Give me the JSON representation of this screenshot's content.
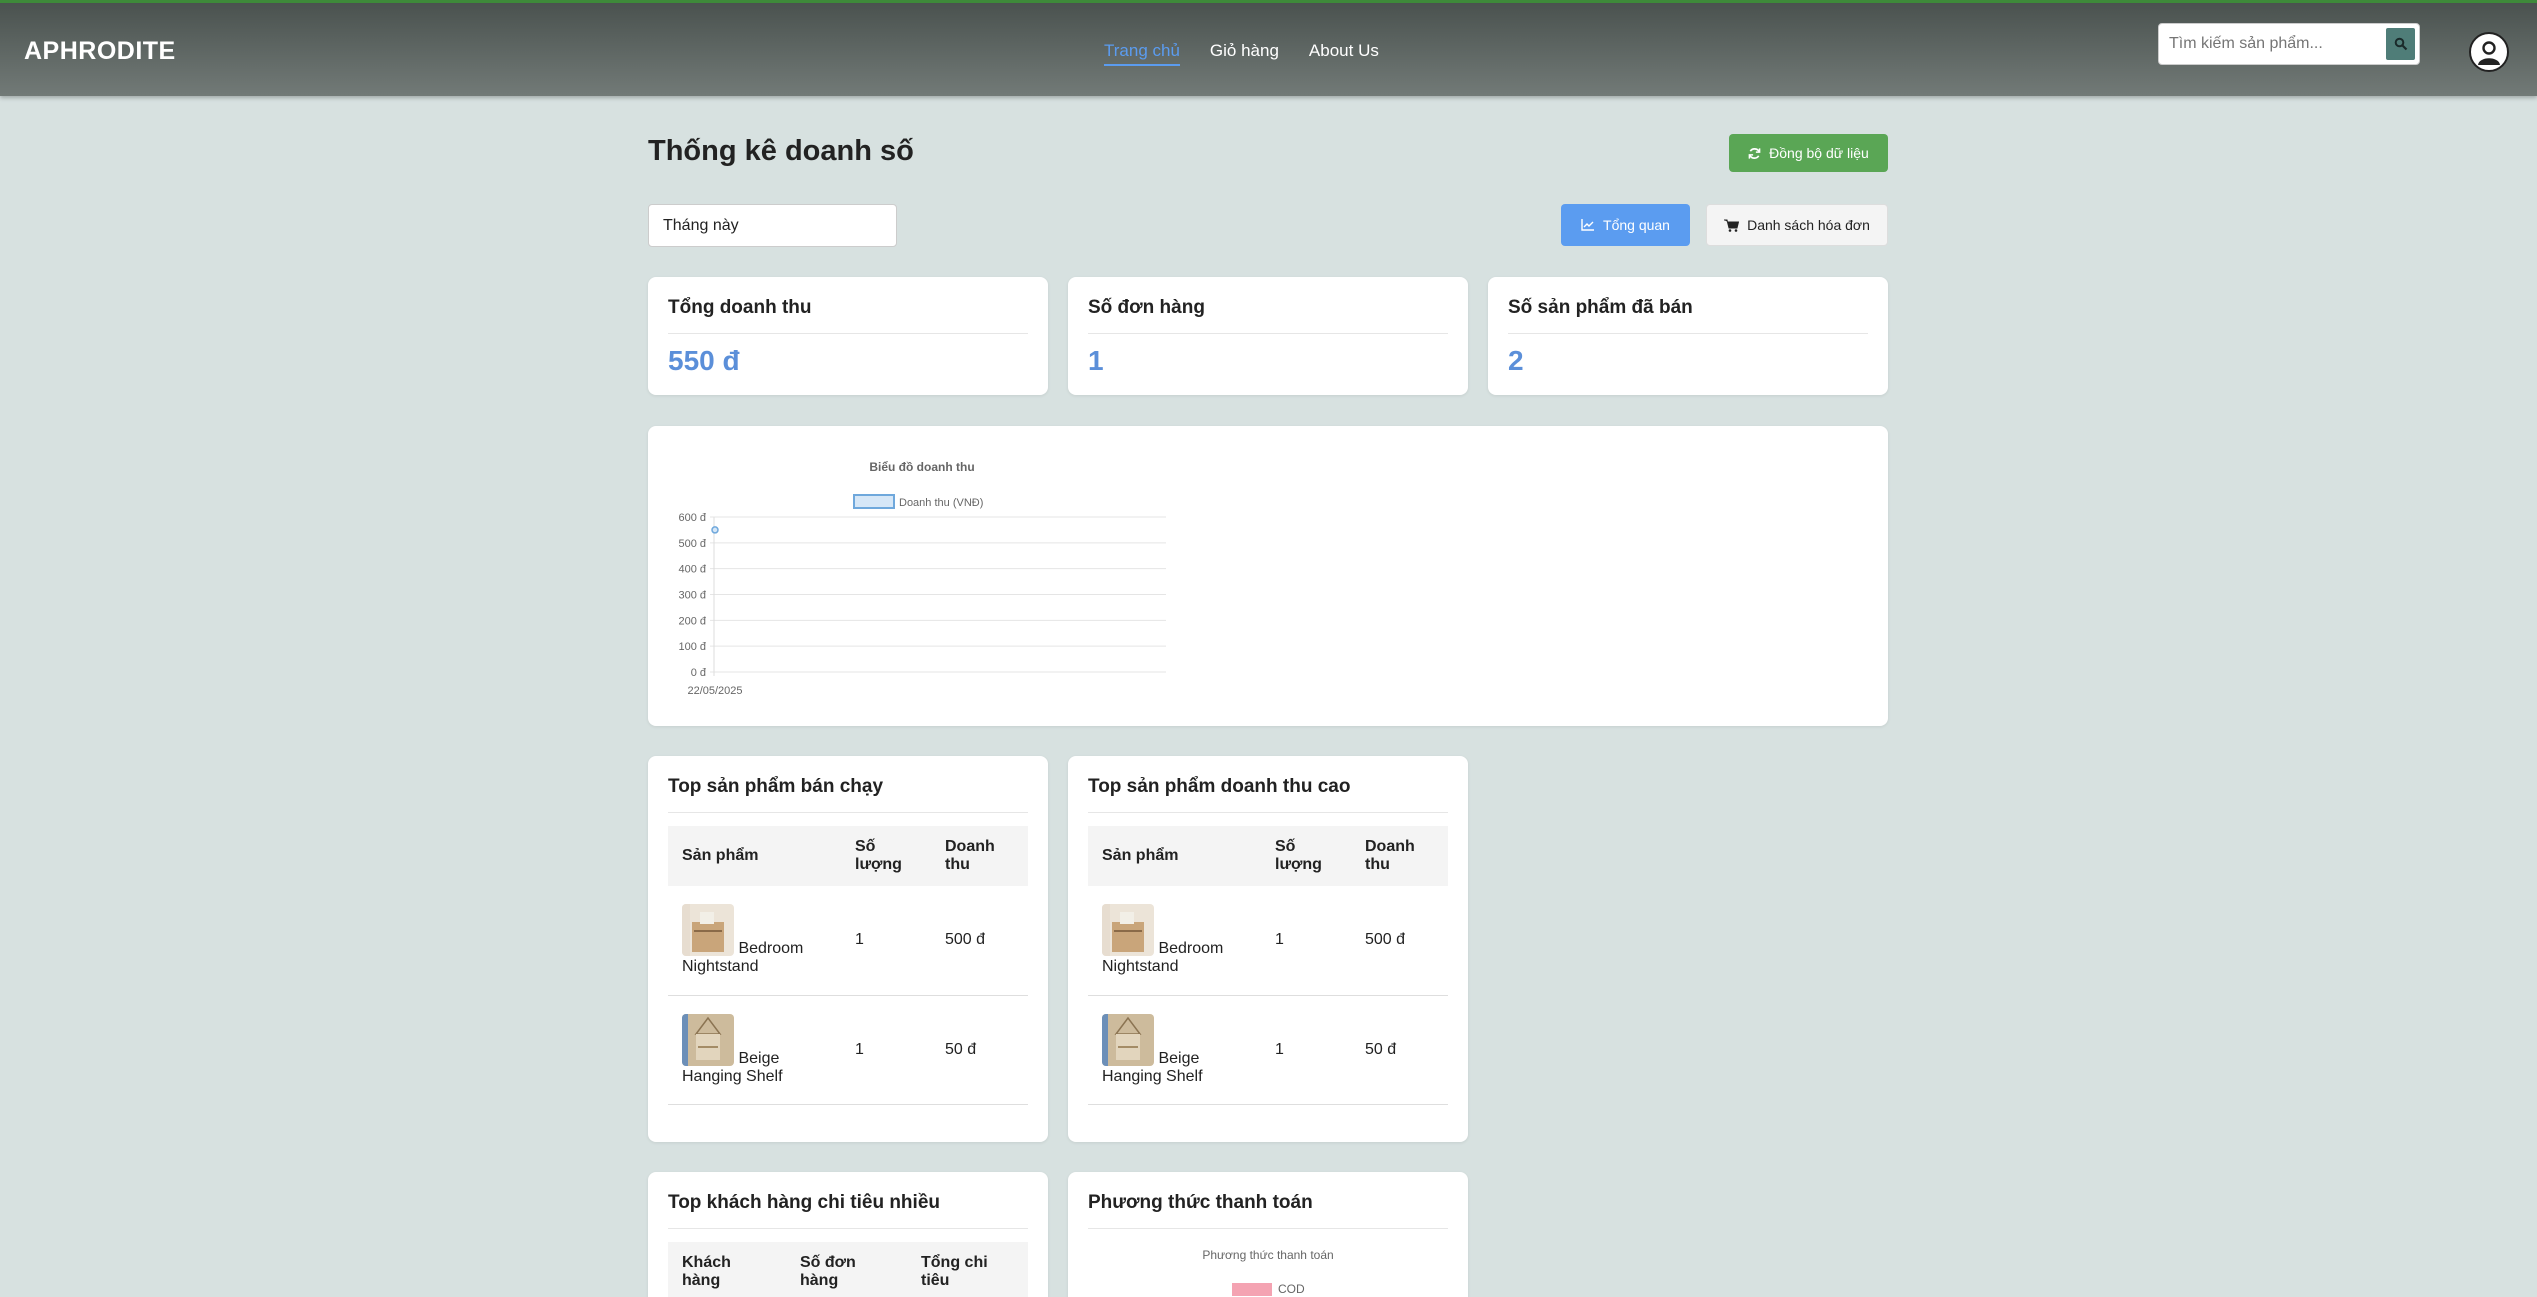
{
  "header": {
    "brand": "APHRODITE",
    "nav": [
      {
        "label": "Trang chủ",
        "active": true
      },
      {
        "label": "Giỏ hàng",
        "active": false
      },
      {
        "label": "About Us",
        "active": false
      }
    ],
    "search_placeholder": "Tìm kiếm sản phẩm...",
    "search_icon": "search-icon",
    "avatar_icon": "user-icon"
  },
  "page": {
    "title": "Thống kê doanh số",
    "sync_label": "Đồng bộ dữ liệu",
    "period_value": "Tháng này",
    "overview_label": "Tổng quan",
    "invoices_label": "Danh sách hóa đơn"
  },
  "stats": [
    {
      "label": "Tổng doanh thu",
      "value": "550 đ"
    },
    {
      "label": "Số đơn hàng",
      "value": "1"
    },
    {
      "label": "Số sản phẩm đã bán",
      "value": "2"
    }
  ],
  "chart_data": {
    "type": "line",
    "title": "Biểu đồ doanh thu",
    "categories": [
      "22/05/2025"
    ],
    "series": [
      {
        "name": "Doanh thu (VNĐ)",
        "values": [
          550
        ]
      }
    ],
    "y_ticks": [
      "600 đ",
      "500 đ",
      "400 đ",
      "300 đ",
      "200 đ",
      "100 đ",
      "0 đ"
    ],
    "ylim": [
      0,
      600
    ],
    "legend": "top",
    "colors": {
      "line": "#6fa8dc",
      "fill": "#d6e7f7"
    }
  },
  "top_products": {
    "title": "Top sản phẩm bán chạy",
    "headers": [
      "Sản phẩm",
      "Số lượng",
      "Doanh thu"
    ],
    "rows": [
      {
        "name": "Bedroom Nightstand",
        "qty": "1",
        "revenue": "500 đ"
      },
      {
        "name": "Beige Hanging Shelf",
        "qty": "1",
        "revenue": "50 đ"
      }
    ]
  },
  "top_revenue": {
    "title": "Top sản phẩm doanh thu cao",
    "headers": [
      "Sản phẩm",
      "Số lượng",
      "Doanh thu"
    ],
    "rows": [
      {
        "name": "Bedroom Nightstand",
        "qty": "1",
        "revenue": "500 đ"
      },
      {
        "name": "Beige Hanging Shelf",
        "qty": "1",
        "revenue": "50 đ"
      }
    ]
  },
  "top_customers": {
    "title": "Top khách hàng chi tiêu nhiều",
    "headers": [
      "Khách hàng",
      "Số đơn hàng",
      "Tổng chi tiêu"
    ]
  },
  "payment": {
    "title": "Phương thức thanh toán",
    "chart_title": "Phương thức thanh toán",
    "legend_label": "COD",
    "legend_color": "#f4a3b2"
  }
}
